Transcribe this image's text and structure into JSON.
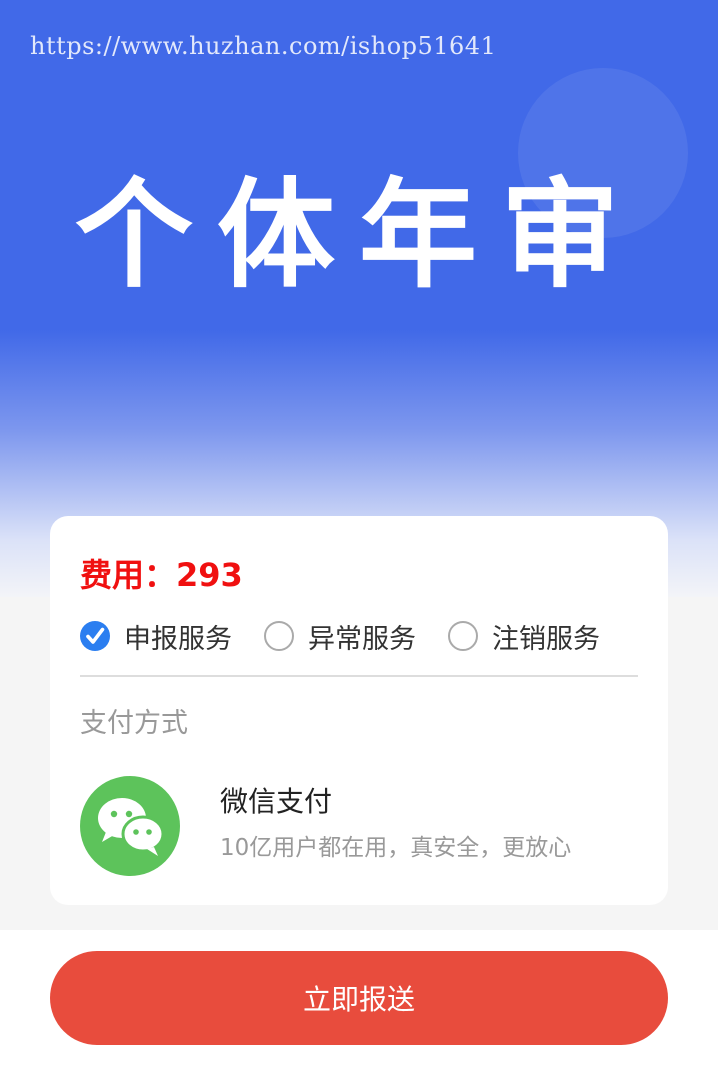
{
  "header": {
    "watermark": "https://www.huzhan.com/ishop51641",
    "title": "个体年审"
  },
  "card": {
    "fee": "费用：293",
    "options": [
      {
        "label": "申报服务",
        "checked": true
      },
      {
        "label": "异常服务",
        "checked": false
      },
      {
        "label": "注销服务",
        "checked": false
      }
    ],
    "payment_title": "支付方式",
    "payment": {
      "name": "微信支付",
      "description": "10亿用户都在用，真安全，更放心",
      "icon": "wechat-icon"
    }
  },
  "footer": {
    "submit_label": "立即报送"
  },
  "colors": {
    "header_blue": "#4169e8",
    "fee_red": "#f01010",
    "radio_blue": "#2b7ef0",
    "wechat_green": "#5dc35b",
    "button_red": "#e84c3d"
  }
}
